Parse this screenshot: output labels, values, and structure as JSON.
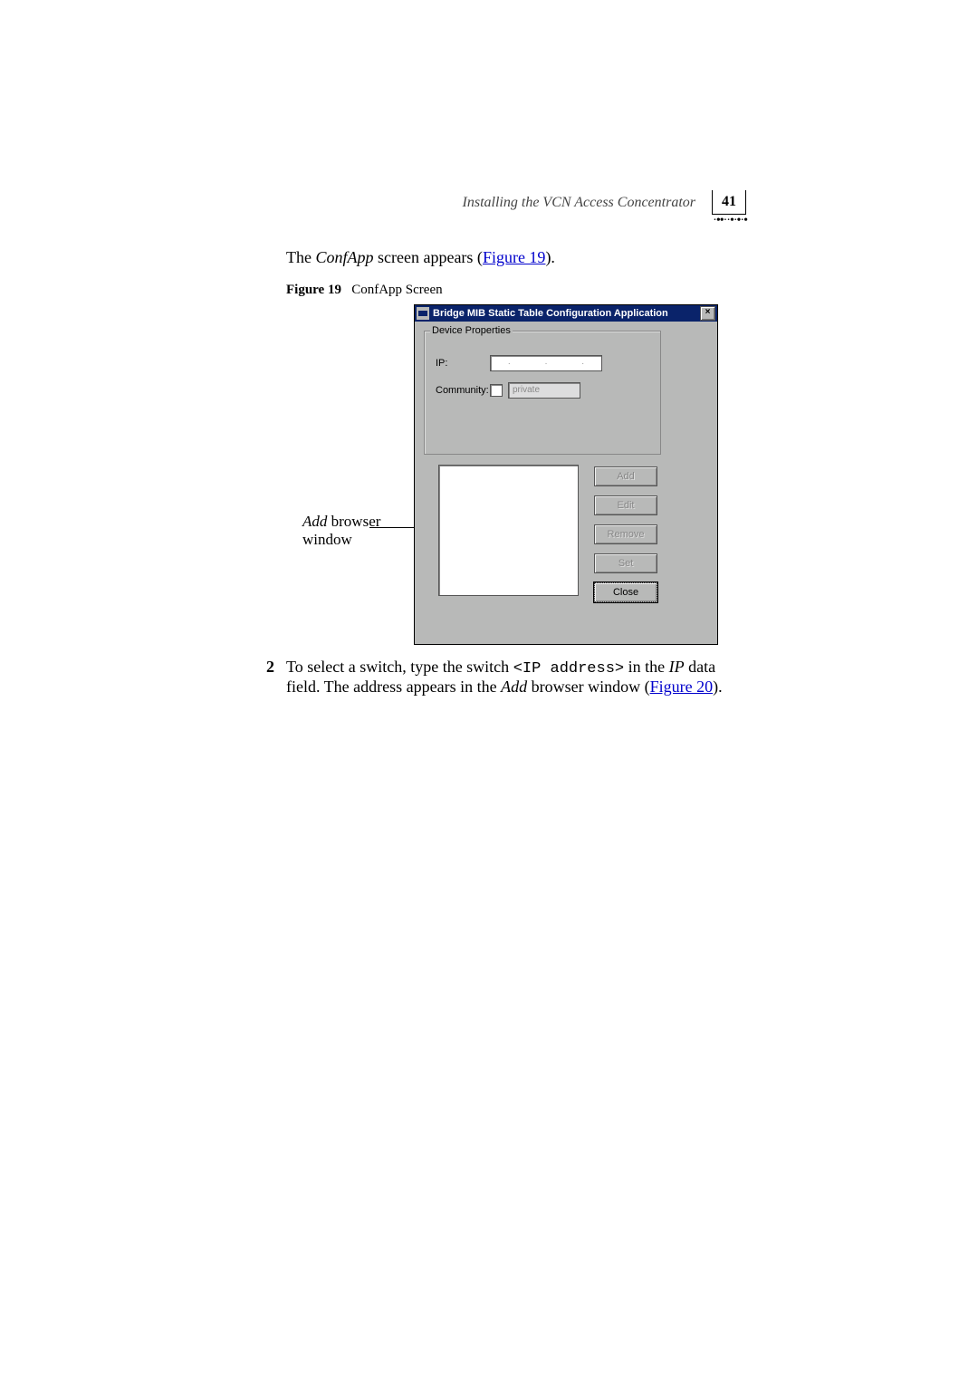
{
  "header": {
    "running_title": "Installing the VCN Access Concentrator",
    "page_number": "41"
  },
  "intro": {
    "text_prefix": "The ",
    "text_app": "ConfApp",
    "text_middle": " screen appears (",
    "figure_link": "Figure 19",
    "text_suffix": ")."
  },
  "figure": {
    "label": "Figure 19",
    "caption": "ConfApp Screen"
  },
  "annotation": {
    "italic": "Add",
    "rest": " browser window"
  },
  "dialog": {
    "title": "Bridge MIB Static Table Configuration Application",
    "close_glyph": "×",
    "groupbox_label": "Device Properties",
    "ip_label": "IP:",
    "ip_dots": [
      "·",
      "·",
      "·"
    ],
    "community_label": "Community:",
    "community_value": "private",
    "buttons": {
      "add": "Add",
      "edit": "Edit",
      "remove": "Remove",
      "set": "Set",
      "close": "Close"
    }
  },
  "step": {
    "num": "2",
    "t1": "To select a switch, type the switch ",
    "code": "<IP address>",
    "t2": " in the ",
    "ip_italic": "IP",
    "t3": " data field. The address appears in the ",
    "add_italic": "Add",
    "t4": " browser window (",
    "figure_link": "Figure 20",
    "t5": ")."
  }
}
